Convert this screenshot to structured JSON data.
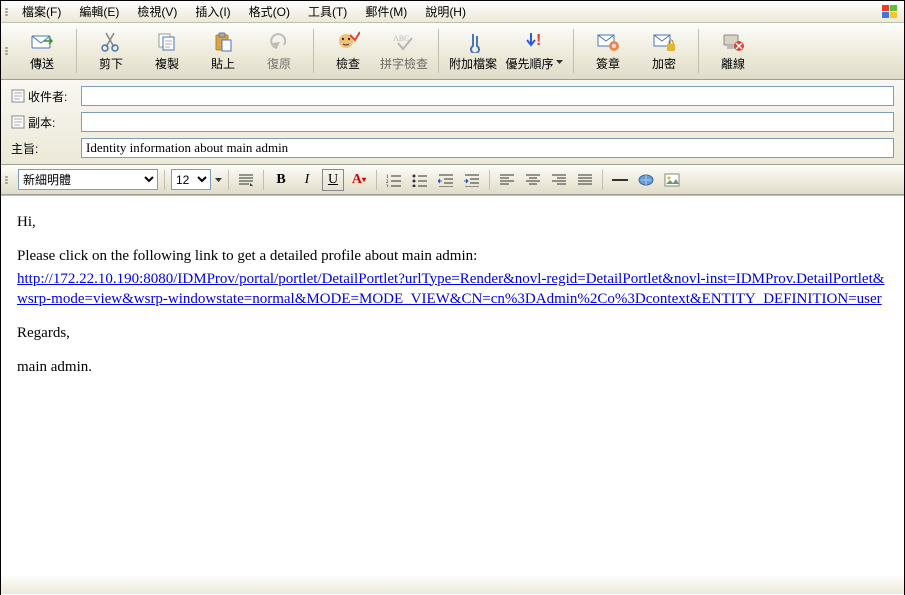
{
  "menu": {
    "file": "檔案(F)",
    "edit": "編輯(E)",
    "view": "檢視(V)",
    "insert": "插入(I)",
    "format": "格式(O)",
    "tools": "工具(T)",
    "mail": "郵件(M)",
    "help": "說明(H)"
  },
  "toolbar": {
    "send": "傳送",
    "cut": "剪下",
    "copy": "複製",
    "paste": "貼上",
    "undo": "復原",
    "check": "檢查",
    "spell": "拼字檢查",
    "attach": "附加檔案",
    "priority": "優先順序",
    "sign": "簽章",
    "encrypt": "加密",
    "offline": "離線"
  },
  "fields": {
    "to_label": "收件者:",
    "cc_label": "副本:",
    "subject_label": "主旨:",
    "to_value": "",
    "cc_value": "",
    "subject_value": "Identity information about main admin"
  },
  "format": {
    "font_name": "新細明體",
    "font_size": "12"
  },
  "body": {
    "greeting": "Hi,",
    "intro": "Please click on the following link to get a detailed profile about main admin:",
    "link_text": "http://172.22.10.190:8080/IDMProv/portal/portlet/DetailPortlet?urlType=Render&novl-regid=DetailPortlet&novl-inst=IDMProv.DetailPortlet&wsrp-mode=view&wsrp-windowstate=normal&MODE=MODE_VIEW&CN=cn%3DAdmin%2Co%3Dcontext&ENTITY_DEFINITION=user",
    "regards": "Regards,",
    "signature": "main admin."
  }
}
